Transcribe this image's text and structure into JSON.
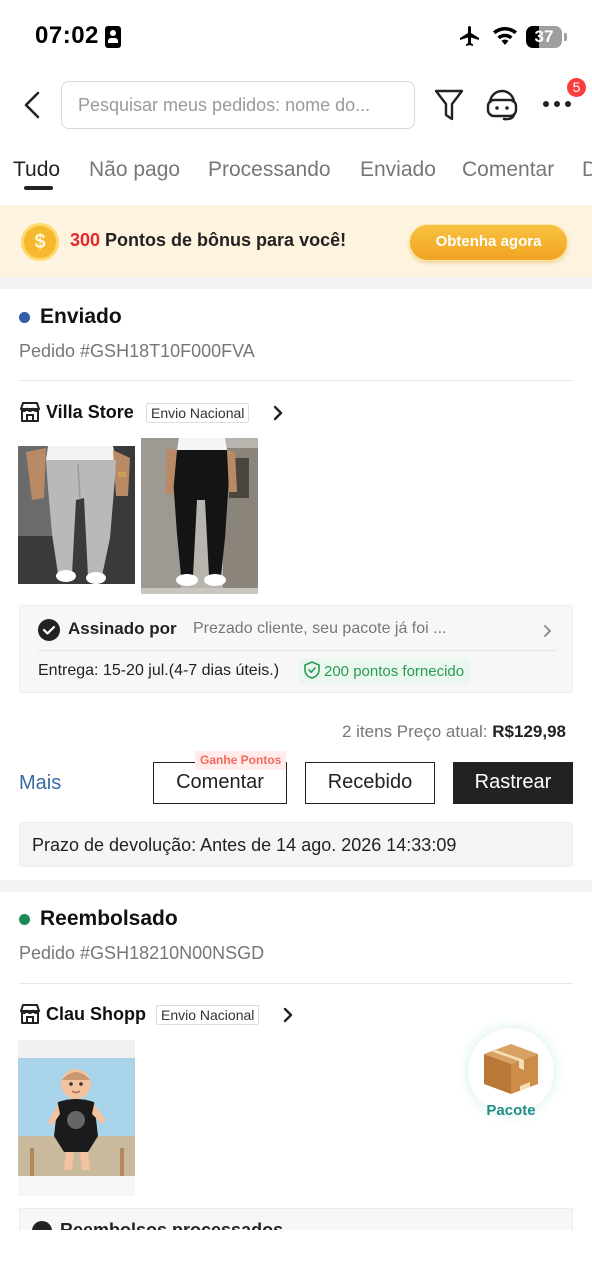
{
  "status_bar": {
    "time": "07:02",
    "battery": "37",
    "battery_fraction": 0.37
  },
  "header": {
    "search_placeholder": "Pesquisar meus pedidos: nome do...",
    "notification_count": "5"
  },
  "tabs": [
    {
      "label": "Tudo",
      "active": true
    },
    {
      "label": "Não pago"
    },
    {
      "label": "Processando"
    },
    {
      "label": "Enviado"
    },
    {
      "label": "Comentar"
    },
    {
      "label": "D"
    }
  ],
  "bonus": {
    "points": "300",
    "text": " Pontos de bônus para você!",
    "button": "Obtenha agora"
  },
  "orders": [
    {
      "status": "Enviado",
      "status_color": "#2f5fa8",
      "order_number": "Pedido #GSH18T10F000FVA",
      "store": "Villa Store",
      "shipping": "Envio Nacional",
      "tracking": {
        "title": "Assinado por",
        "message": "Prezado cliente, seu pacote já foi ...",
        "delivery": "Entrega: 15-20 jul.(4-7 dias úteis.)",
        "points": "200 pontos fornecido"
      },
      "items_count": "2 itens",
      "price_label": "Preço atual:",
      "price": "R$129,98",
      "more": "Mais",
      "earn_points": "Ganhe Pontos",
      "buttons": {
        "comment": "Comentar",
        "received": "Recebido",
        "track": "Rastrear"
      },
      "return_deadline": "Prazo de devolução: Antes de 14 ago. 2026 14:33:09"
    },
    {
      "status": "Reembolsado",
      "status_color": "#1d8a5a",
      "order_number": "Pedido #GSH18210N00NSGD",
      "store": "Clau Shopp",
      "shipping": "Envio Nacional",
      "package_label": "Pacote",
      "peek_text": "Reembolsos processados"
    }
  ]
}
